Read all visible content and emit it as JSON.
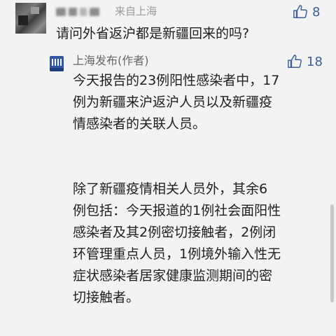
{
  "comment": {
    "location": "来自上海",
    "text": "请问外省返沪都是新疆回来的吗?",
    "like_count": "8"
  },
  "reply": {
    "author": "上海发布(作者)",
    "like_count": "18",
    "paragraph1": [
      "今天报告的23例阳性感染者中，17",
      "例为新疆来沪返沪人员以及新疆疫",
      "情感染者的关联人员。"
    ],
    "paragraph2": [
      "除了新疆疫情相关人员外，其余6",
      "例包括：今天报道的1例社会面阳性",
      "感染者及其2例密切接触者，2例闭",
      "环管理重点人员，1例境外输入性无",
      "症状感染者居家健康监测期间的密",
      "切接触者。"
    ]
  },
  "icons": {
    "like": "thumbs-up-icon",
    "avatar": "user-avatar",
    "publisher_logo": "shanghai-fabu-logo"
  },
  "colors": {
    "background": "#f3f3f3",
    "like_blue": "#3a5f99",
    "meta_gray": "#9a9a9a"
  }
}
